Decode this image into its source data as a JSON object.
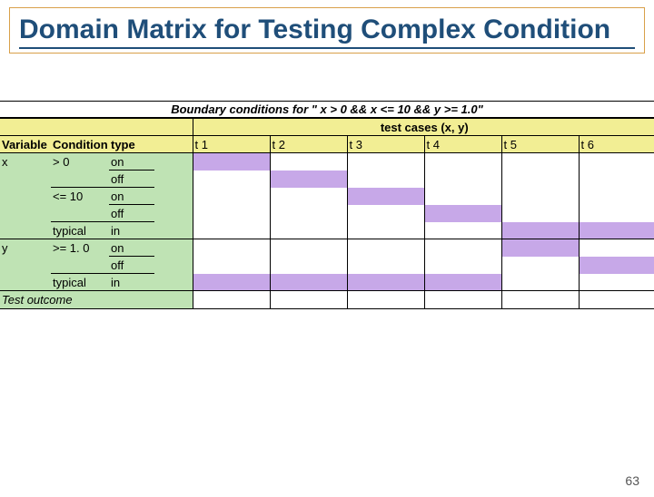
{
  "title": "Domain Matrix for Testing Complex Condition",
  "boundary_title": "Boundary conditions for \" x > 0 && x <= 10 && y >= 1.0\"",
  "testcases_header": "test cases (x, y)",
  "headers": {
    "variable": "Variable",
    "condition": "Condition",
    "type": "type",
    "t1": "t 1",
    "t2": "t 2",
    "t3": "t 3",
    "t4": "t 4",
    "t5": "t 5",
    "t6": "t 6"
  },
  "rows": [
    {
      "variable": "x",
      "condition": "> 0",
      "type": "on",
      "purple_col": 0
    },
    {
      "variable": "",
      "condition": "",
      "type": "off",
      "purple_col": 1
    },
    {
      "variable": "",
      "condition": "<= 10",
      "type": "on",
      "purple_col": 2
    },
    {
      "variable": "",
      "condition": "",
      "type": "off",
      "purple_col": 3
    },
    {
      "variable": "",
      "condition": "typical",
      "type": "in",
      "purple_col": null,
      "purple_cols": [
        4,
        5
      ]
    },
    {
      "variable": "y",
      "condition": ">= 1. 0",
      "type": "on",
      "purple_col": 4
    },
    {
      "variable": "",
      "condition": "",
      "type": "off",
      "purple_col": 5
    },
    {
      "variable": "",
      "condition": "typical",
      "type": "in",
      "purple_col": null,
      "purple_cols": [
        0,
        1,
        2,
        3
      ]
    }
  ],
  "outcome_label": "Test outcome",
  "page_number": "63",
  "colors": {
    "title": "#1f4e79",
    "title_border": "#d9a04a",
    "header_yellow": "#f2ee94",
    "row_green": "#bfe3b4",
    "cell_purple": "#c7a8e8"
  }
}
